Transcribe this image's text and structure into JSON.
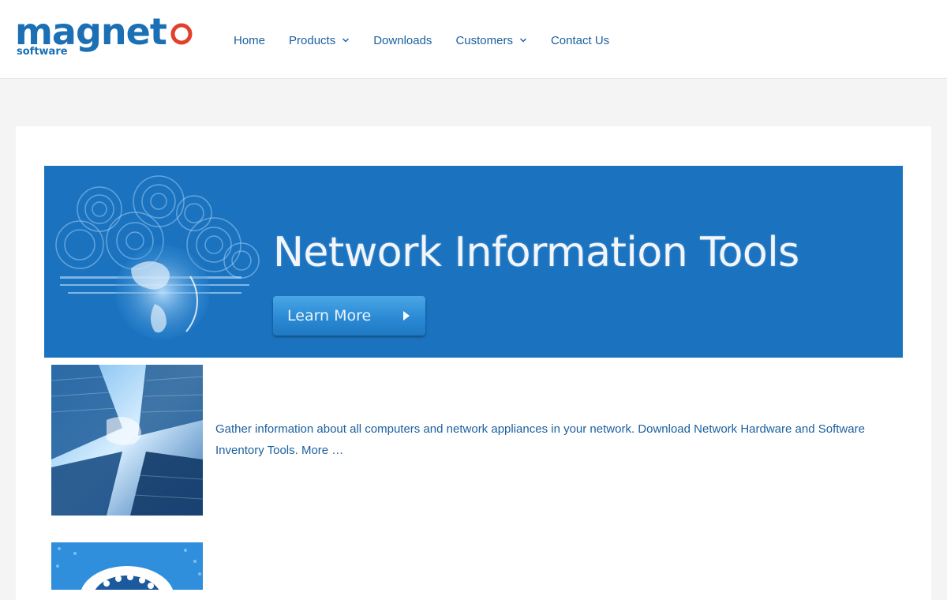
{
  "brand": {
    "name": "magnet",
    "sub": "software",
    "colors": {
      "primary": "#1a6fb5",
      "accent": "#e2402a"
    }
  },
  "nav": {
    "items": [
      {
        "label": "Home",
        "has_dropdown": false
      },
      {
        "label": "Products",
        "has_dropdown": true
      },
      {
        "label": "Downloads",
        "has_dropdown": false
      },
      {
        "label": "Customers",
        "has_dropdown": true
      },
      {
        "label": "Contact Us",
        "has_dropdown": false
      }
    ]
  },
  "banner": {
    "title": "Network Information Tools",
    "button_label": "Learn More",
    "icons": [
      "globe-icon",
      "play-arrow-icon"
    ]
  },
  "features": [
    {
      "text": "Gather information about all computers and network appliances in your network. Download Network Hardware and Software Inventory Tools.",
      "link_label": "More …",
      "image": "city-skyscrapers-image"
    },
    {
      "image": "circuit-brain-image"
    }
  ],
  "icons": {
    "chevron": "chevron-down-icon",
    "logo_ring": "logo-ring-icon"
  }
}
